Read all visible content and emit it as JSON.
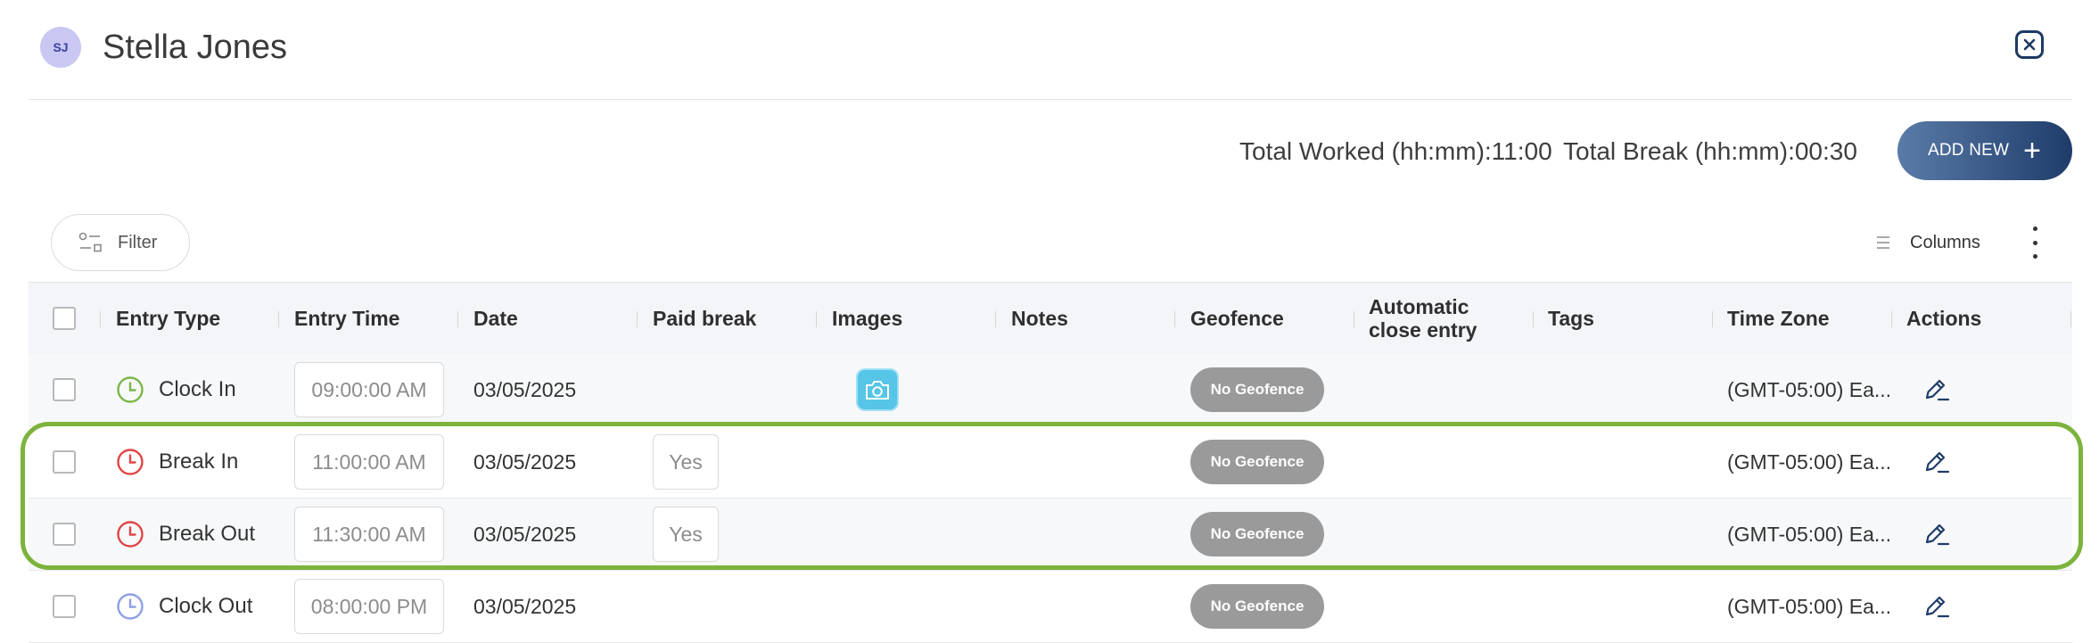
{
  "header": {
    "avatar_initials": "SJ",
    "user_name": "Stella Jones",
    "close_icon": "close-icon"
  },
  "totals": {
    "worked": "Total Worked (hh:mm):11:00",
    "break": "Total Break (hh:mm):00:30"
  },
  "add_new": {
    "label": "ADD NEW",
    "icon": "plus-icon"
  },
  "toolbar": {
    "filter_label": "Filter",
    "filter_icon": "filter-icon",
    "columns_label": "Columns",
    "columns_icon": "columns-icon",
    "more_icon": "more-vertical-icon"
  },
  "table": {
    "columns": [
      "Entry Type",
      "Entry Time",
      "Date",
      "Paid break",
      "Images",
      "Notes",
      "Geofence",
      "Automatic close entry",
      "Tags",
      "Time Zone",
      "Actions"
    ],
    "rows": [
      {
        "entry_type": "Clock In",
        "icon": "clock-in-icon",
        "icon_color": "#7ab648",
        "time": "09:00:00 AM",
        "date": "03/05/2025",
        "paid_break": "",
        "has_image": true,
        "geofence": "No Geofence",
        "time_zone": "(GMT-05:00) Ea...",
        "action_icon": "edit-icon"
      },
      {
        "entry_type": "Break In",
        "icon": "break-in-icon",
        "icon_color": "#e04545",
        "time": "11:00:00 AM",
        "date": "03/05/2025",
        "paid_break": "Yes",
        "has_image": false,
        "geofence": "No Geofence",
        "time_zone": "(GMT-05:00) Ea...",
        "action_icon": "edit-icon"
      },
      {
        "entry_type": "Break Out",
        "icon": "break-out-icon",
        "icon_color": "#e04545",
        "time": "11:30:00 AM",
        "date": "03/05/2025",
        "paid_break": "Yes",
        "has_image": false,
        "geofence": "No Geofence",
        "time_zone": "(GMT-05:00) Ea...",
        "action_icon": "edit-icon"
      },
      {
        "entry_type": "Clock Out",
        "icon": "clock-out-icon",
        "icon_color": "#8c9fe6",
        "time": "08:00:00 PM",
        "date": "03/05/2025",
        "paid_break": "",
        "has_image": false,
        "geofence": "No Geofence",
        "time_zone": "(GMT-05:00) Ea...",
        "action_icon": "edit-icon"
      }
    ]
  },
  "colors": {
    "accent": "#1f3c6a",
    "highlight": "#7cb33c",
    "badge": "#9a9a9a",
    "camera": "#56c5e8"
  }
}
